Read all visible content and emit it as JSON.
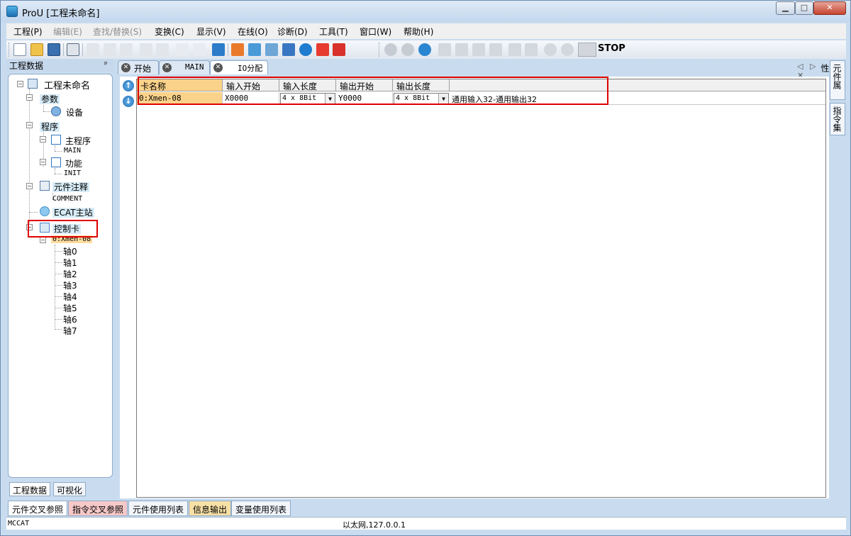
{
  "window": {
    "title": "ProU [工程未命名]",
    "min_glyph": "▁",
    "max_glyph": "□",
    "close_glyph": "✕"
  },
  "menu": [
    {
      "label": "工程(P)",
      "disabled": false
    },
    {
      "label": "编辑(E)",
      "disabled": true
    },
    {
      "label": "查找/替换(S)",
      "disabled": true
    },
    {
      "label": "变换(C)",
      "disabled": false
    },
    {
      "label": "显示(V)",
      "disabled": false
    },
    {
      "label": "在线(O)",
      "disabled": false
    },
    {
      "label": "诊断(D)",
      "disabled": false
    },
    {
      "label": "工具(T)",
      "disabled": false
    },
    {
      "label": "窗口(W)",
      "disabled": false
    },
    {
      "label": "帮助(H)",
      "disabled": false
    }
  ],
  "toolbar": {
    "stop_label": "STOP",
    "icons": [
      "new-file-icon",
      "open-folder-icon",
      "save-icon",
      "print-icon",
      "cut-icon",
      "copy-icon",
      "paste-icon",
      "undo-icon",
      "redo-icon",
      "dev-icon",
      "search-device-icon",
      "download-icon",
      "compile-icon",
      "io-icon",
      "grid-icon",
      "connect-icon",
      "pause-icon",
      "upload-icon",
      "download-red-icon",
      "run-icon",
      "stop-icon",
      "refresh-icon",
      "ladder-1-icon",
      "ladder-2-icon",
      "ladder-3-icon",
      "ladder-4-icon",
      "block-1-icon",
      "block-2-icon",
      "zoom-in-icon",
      "zoom-out-icon"
    ]
  },
  "left_panel": {
    "title": "工程数据",
    "pin": "ᵖ",
    "tree": {
      "root": "工程未命名",
      "params": "参数",
      "device": "设备",
      "program": "程序",
      "main_program": "主程序",
      "main": "MAIN",
      "function": "功能",
      "init": "INIT",
      "comment_group": "元件注释",
      "comment": "COMMENT",
      "ecat": "ECAT主站",
      "control_card": "控制卡",
      "card0": "0:Xmen-08",
      "axes": [
        "轴0",
        "轴1",
        "轴2",
        "轴3",
        "轴4",
        "轴5",
        "轴6",
        "轴7"
      ]
    },
    "tabs": [
      "工程数据",
      "可视化"
    ]
  },
  "doc_tabs": [
    {
      "label": "开始"
    },
    {
      "label": "MAIN"
    },
    {
      "label": "IO分配"
    }
  ],
  "tab_nav": "◁ ▷ ✕",
  "io_table": {
    "headers": [
      "卡名称",
      "输入开始",
      "输入长度",
      "输出开始",
      "输出长度"
    ],
    "row": {
      "card_name": "0:Xmen-08",
      "input_start": "X0000",
      "input_length": "4 x 8Bit",
      "output_start": "Y0000",
      "output_length": "4 x 8Bit",
      "remark": "通用输入32-通用输出32"
    },
    "combo_arrow": "▼"
  },
  "right_tabs": [
    "元件属性",
    "指令集"
  ],
  "bottom_tabs": [
    {
      "label": "元件交叉参照",
      "style": "active"
    },
    {
      "label": "指令交叉参照",
      "style": "pink"
    },
    {
      "label": "元件使用列表",
      "style": ""
    },
    {
      "label": "信息输出",
      "style": "yellow"
    },
    {
      "label": "变量使用列表",
      "style": ""
    }
  ],
  "status": {
    "left": "MCCAT",
    "mid": "以太网,127.0.0.1"
  },
  "colors": {
    "highlight_box": "#e00000",
    "selected_card": "#fbd28a"
  }
}
